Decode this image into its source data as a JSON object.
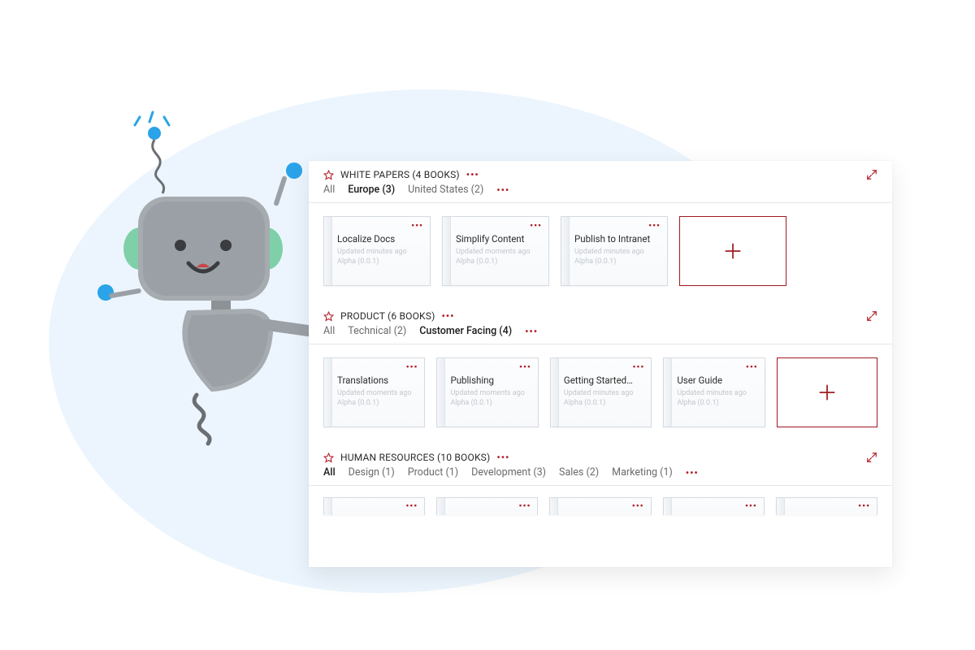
{
  "colors": {
    "accent": "#b21f28",
    "border": "#d4dbe1",
    "textMuted": "#6a6a6a"
  },
  "sections": [
    {
      "title": "WHITE PAPERS (4 BOOKS)",
      "filters": [
        {
          "label": "All",
          "active": false
        },
        {
          "label": "Europe (3)",
          "active": true
        },
        {
          "label": "United States (2)",
          "active": false
        }
      ],
      "cards": [
        {
          "title": "Localize Docs",
          "meta1": "Updated minutes ago",
          "meta2": "Alpha (0.0.1)"
        },
        {
          "title": "Simplify Content",
          "meta1": "Updated moments ago",
          "meta2": "Alpha (0.0.1)"
        },
        {
          "title": "Publish to Intranet",
          "meta1": "Updated minutes ago",
          "meta2": "Alpha (0.0.1)"
        }
      ],
      "showAdd": true,
      "peek": false
    },
    {
      "title": "PRODUCT (6 BOOKS)",
      "filters": [
        {
          "label": "All",
          "active": false
        },
        {
          "label": "Technical (2)",
          "active": false
        },
        {
          "label": "Customer Facing (4)",
          "active": true
        }
      ],
      "cards": [
        {
          "title": "Translations",
          "meta1": "Updated moments ago",
          "meta2": "Alpha (0.0.1)"
        },
        {
          "title": "Publishing",
          "meta1": "Updated moments ago",
          "meta2": "Alpha (0.0.1)"
        },
        {
          "title": "Getting Started…",
          "meta1": "Updated minutes ago",
          "meta2": "Alpha (0.0.1)"
        },
        {
          "title": "User Guide",
          "meta1": "Updated minutes ago",
          "meta2": "Alpha (0.0.1)"
        }
      ],
      "showAdd": true,
      "peek": false
    },
    {
      "title": "HUMAN RESOURCES (10 BOOKS)",
      "filters": [
        {
          "label": "All",
          "active": true
        },
        {
          "label": "Design (1)",
          "active": false
        },
        {
          "label": "Product (1)",
          "active": false
        },
        {
          "label": "Development (3)",
          "active": false
        },
        {
          "label": "Sales (2)",
          "active": false
        },
        {
          "label": "Marketing (1)",
          "active": false
        }
      ],
      "cards": [
        {
          "title": "",
          "meta1": "",
          "meta2": ""
        },
        {
          "title": "",
          "meta1": "",
          "meta2": ""
        },
        {
          "title": "",
          "meta1": "",
          "meta2": ""
        },
        {
          "title": "",
          "meta1": "",
          "meta2": ""
        },
        {
          "title": "",
          "meta1": "",
          "meta2": ""
        }
      ],
      "showAdd": false,
      "peek": true
    }
  ]
}
